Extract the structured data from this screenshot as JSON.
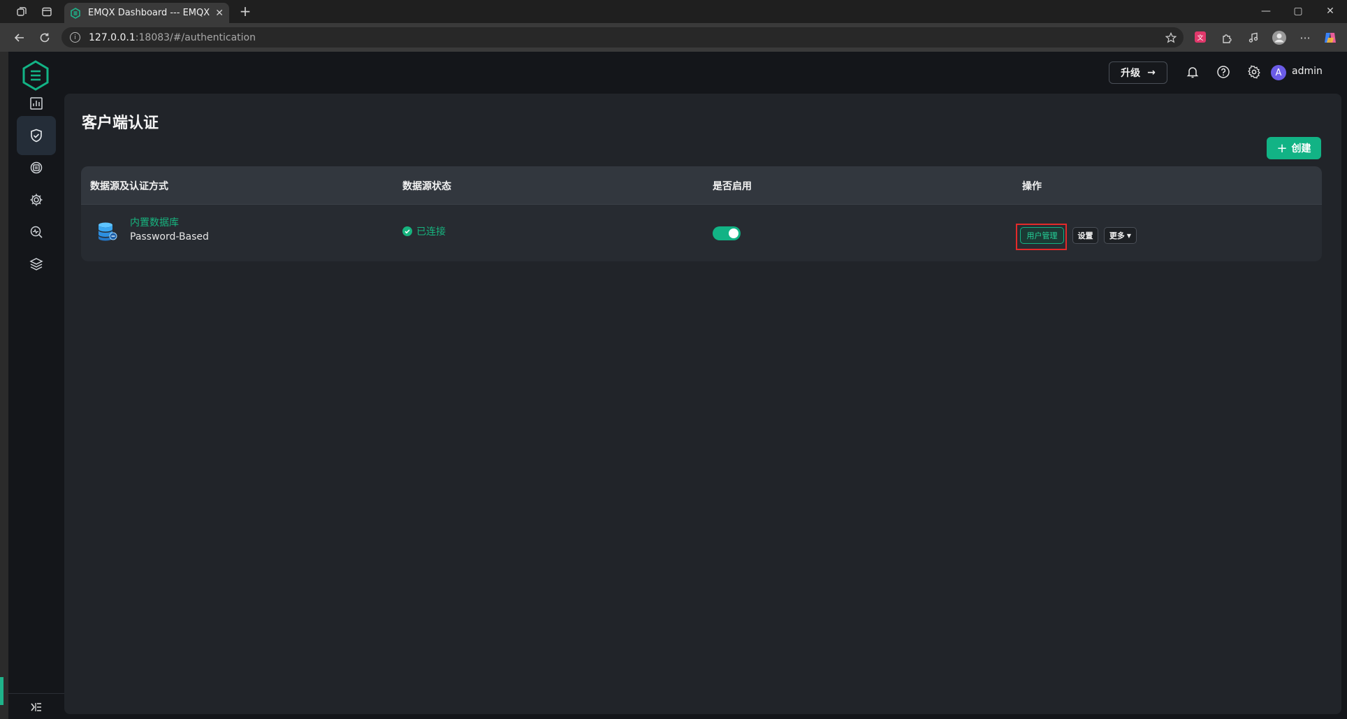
{
  "browser": {
    "tab_title": "EMQX Dashboard --- EMQX Dashb",
    "tab_close": "✕",
    "new_tab": "+",
    "url_host": "127.0.0.1",
    "url_rest": ":18083/#/authentication",
    "window_controls": [
      "—",
      "▢",
      "✕"
    ]
  },
  "header": {
    "upgrade_label": "升级",
    "upgrade_arrow": "→",
    "username": "admin",
    "avatar_letter": "A"
  },
  "page": {
    "title": "客户端认证",
    "create_label": "创建",
    "create_plus": "+"
  },
  "table": {
    "columns": [
      "数据源及认证方式",
      "数据源状态",
      "是否启用",
      "操作"
    ],
    "rows": [
      {
        "source_name": "内置数据库",
        "mechanism": "Password-Based",
        "status": "已连接",
        "enabled": true,
        "actions": {
          "user_management": "用户管理",
          "settings": "设置",
          "more": "更多"
        }
      }
    ]
  },
  "colors": {
    "accent": "#12b385",
    "highlight": "#e32a2a"
  },
  "icons": {
    "sidebar": [
      "dashboard-icon",
      "shield-check-icon",
      "integration-icon",
      "settings-gear-icon",
      "diagnose-icon",
      "layers-icon"
    ],
    "header": [
      "bell-icon",
      "help-icon",
      "gear-icon"
    ]
  }
}
